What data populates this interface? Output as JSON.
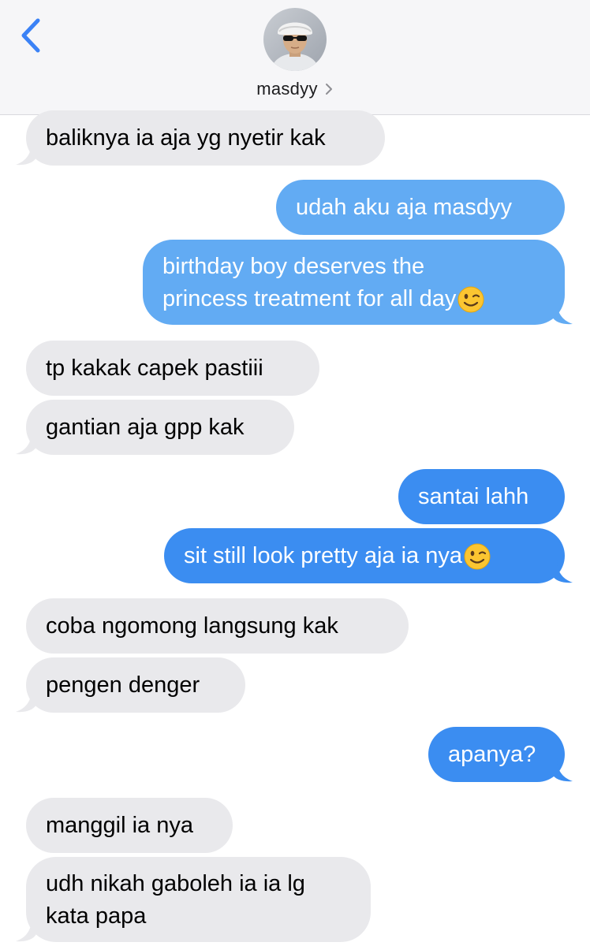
{
  "header": {
    "contact_name": "masdyy",
    "back_icon": "chevron-left-icon",
    "chevron_icon": "chevron-right-icon",
    "accent_color": "#3b82f6"
  },
  "colors": {
    "incoming_bubble": "#e9e9ec",
    "outgoing_bubble": "#3b8df1",
    "outgoing_bubble_faded": "#62abf3",
    "header_background": "#f6f6f8"
  },
  "messages": [
    {
      "direction": "incoming",
      "text": "baliknya ia aja yg nyetir kak"
    },
    {
      "direction": "outgoing",
      "text": "udah aku aja masdyy"
    },
    {
      "direction": "outgoing",
      "text": "birthday boy deserves the\nprincess treatment for all day",
      "emoji": "winking-face-emoji"
    },
    {
      "direction": "incoming",
      "text": "tp kakak capek pastiii"
    },
    {
      "direction": "incoming",
      "text": "gantian aja gpp kak"
    },
    {
      "direction": "outgoing",
      "text": "santai lahh"
    },
    {
      "direction": "outgoing",
      "text": "sit still look pretty aja ia nya",
      "emoji": "winking-face-emoji"
    },
    {
      "direction": "incoming",
      "text": "coba ngomong langsung kak"
    },
    {
      "direction": "incoming",
      "text": "pengen denger"
    },
    {
      "direction": "outgoing",
      "text": "apanya?"
    },
    {
      "direction": "incoming",
      "text": "manggil ia nya"
    },
    {
      "direction": "incoming",
      "text": "udh nikah gaboleh ia ia lg\nkata papa"
    }
  ]
}
